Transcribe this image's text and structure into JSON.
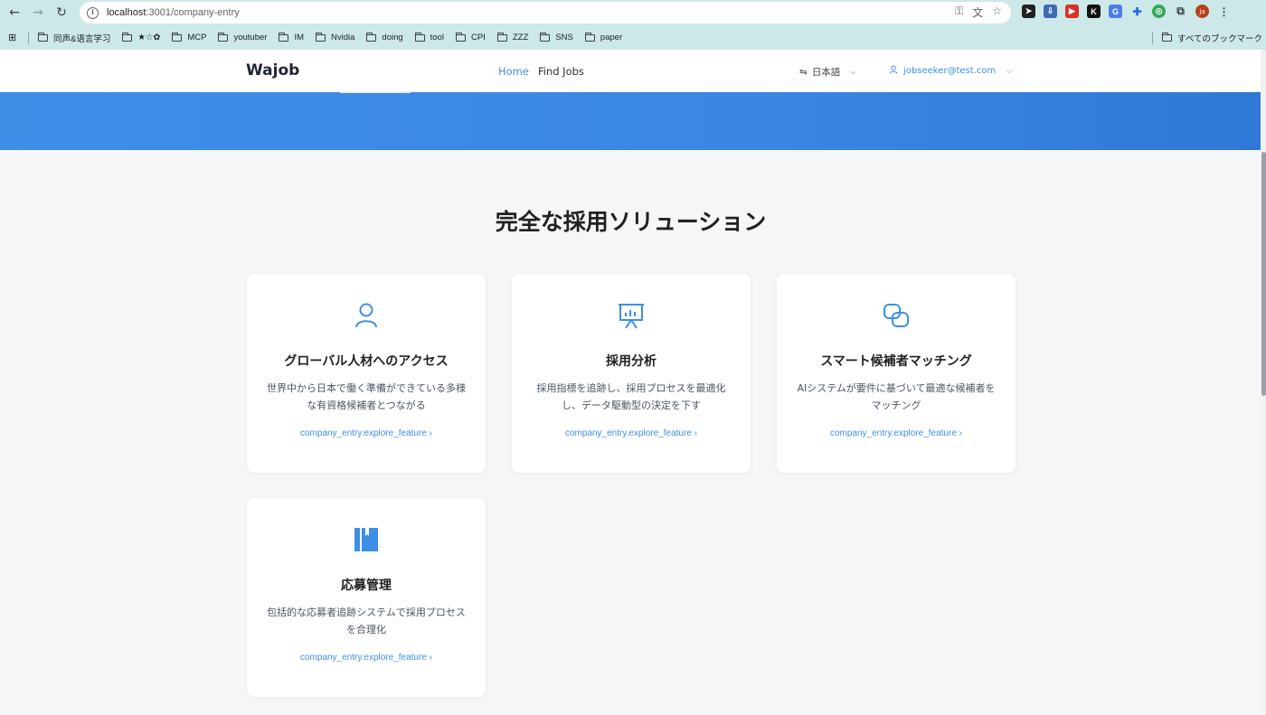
{
  "browser": {
    "url_host": "localhost",
    "url_port": ":3001",
    "url_path": "/company-entry",
    "avatar_text": "ja",
    "bookmarks": [
      "同声&语言学习",
      "★☆✿",
      "MCP",
      "youtuber",
      "IM",
      "Nvidia",
      "doing",
      "tool",
      "CPI",
      "ZZZ",
      "SNS",
      "paper"
    ],
    "all_bookmarks": "すべてのブックマーク"
  },
  "header": {
    "logo": "Wajob",
    "nav": [
      "Home",
      "Find Jobs"
    ],
    "language": "日本語",
    "user_email": "jobseeker@test.com"
  },
  "section": {
    "title": "完全な採用ソリューション"
  },
  "cards": [
    {
      "icon": "user-icon",
      "title": "グローバル人材へのアクセス",
      "desc": "世界中から日本で働く準備ができている多様な有資格候補者とつながる",
      "link": "company_entry.explore_feature"
    },
    {
      "icon": "presentation-chart-icon",
      "title": "採用分析",
      "desc": "採用指標を追跡し、採用プロセスを最適化し、データ駆動型の決定を下す",
      "link": "company_entry.explore_feature"
    },
    {
      "icon": "link-icon",
      "title": "スマート候補者マッチング",
      "desc": "AIシステムが要件に基づいて最適な候補者をマッチング",
      "link": "company_entry.explore_feature"
    },
    {
      "icon": "book-icon",
      "title": "応募管理",
      "desc": "包括的な応募者追跡システムで採用プロセスを合理化",
      "link": "company_entry.explore_feature"
    }
  ],
  "colors": {
    "accent": "#3d8fe8",
    "hero": "#3a86e5"
  }
}
